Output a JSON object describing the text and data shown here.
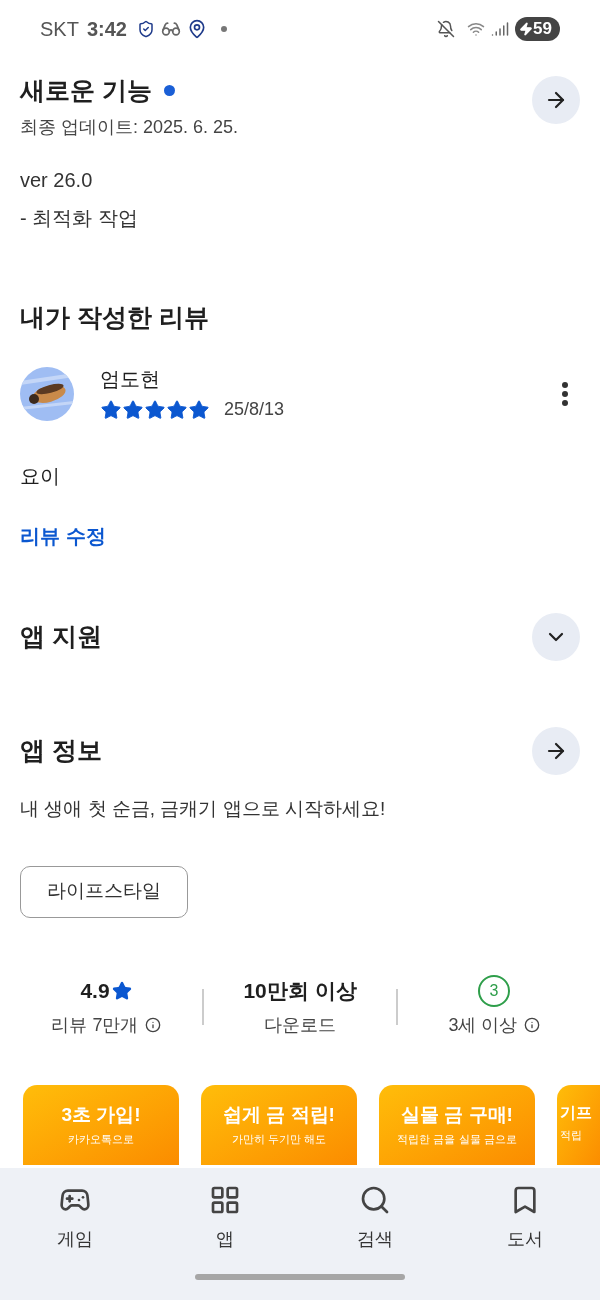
{
  "status_bar": {
    "carrier": "SKT",
    "time": "3:42",
    "battery": "59"
  },
  "whats_new": {
    "title": "새로운 기능",
    "updated": "최종 업데이트: 2025. 6. 25.",
    "lines": [
      "ver 26.0",
      "- 최적화 작업"
    ]
  },
  "my_review": {
    "heading": "내가 작성한 리뷰",
    "author": "엄도현",
    "stars": 5,
    "date": "25/8/13",
    "body": "요이",
    "edit_link": "리뷰 수정"
  },
  "sections": [
    {
      "title": "앱 지원",
      "kind": "expand"
    },
    {
      "title": "앱 정보",
      "kind": "arrow"
    }
  ],
  "description": "내 생애 첫 순금, 금캐기 앱으로 시작하세요!",
  "category_chip": "라이프스타일",
  "stats": [
    {
      "kind": "rating",
      "value": "4.9",
      "label": "리뷰 7만개"
    },
    {
      "kind": "plain",
      "value": "10만회 이상",
      "label": "다운로드"
    },
    {
      "kind": "age",
      "value": "3",
      "label": "3세 이상"
    }
  ],
  "screenshots": [
    {
      "title": "3초 가입!",
      "subtitle": "카카오톡으로",
      "kind": "full"
    },
    {
      "title": "쉽게 금 적립!",
      "subtitle": "가만히 두기만 해도",
      "kind": "full"
    },
    {
      "title": "실물 금 구매!",
      "subtitle": "적립한 금을 실물 금으로",
      "kind": "full"
    },
    {
      "title": "기프",
      "subtitle": "적립",
      "kind": "cut"
    }
  ],
  "nav": [
    {
      "label": "게임"
    },
    {
      "label": "앱"
    },
    {
      "label": "검색"
    },
    {
      "label": "도서"
    }
  ]
}
